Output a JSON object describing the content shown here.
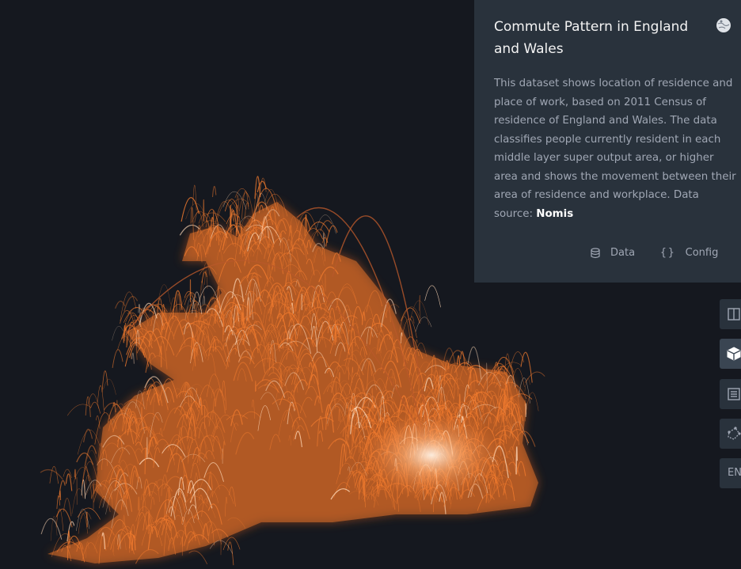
{
  "panel": {
    "title": "Commute Pattern in England and Wales",
    "description": "This dataset shows location of residence and place of work, based on 2011 Census of residence of England and Wales. The data classifies people currently resident in each middle layer super output area, or higher area and shows the movement between their area of residence and workplace. Data source: ",
    "source_link": "Nomis",
    "actions": {
      "data_label": "Data",
      "config_label": "Config"
    }
  },
  "side_controls": {
    "language_label": "EN"
  },
  "icons": [
    "globe-icon",
    "database-icon",
    "braces-icon",
    "split-map-icon",
    "3d-cube-icon",
    "legend-icon",
    "draw-polygon-icon"
  ],
  "colors": {
    "background": "#15181f",
    "panel": "#29323c",
    "arc_orange": "#f07a2e",
    "arc_highlight": "#ffd9b8"
  }
}
